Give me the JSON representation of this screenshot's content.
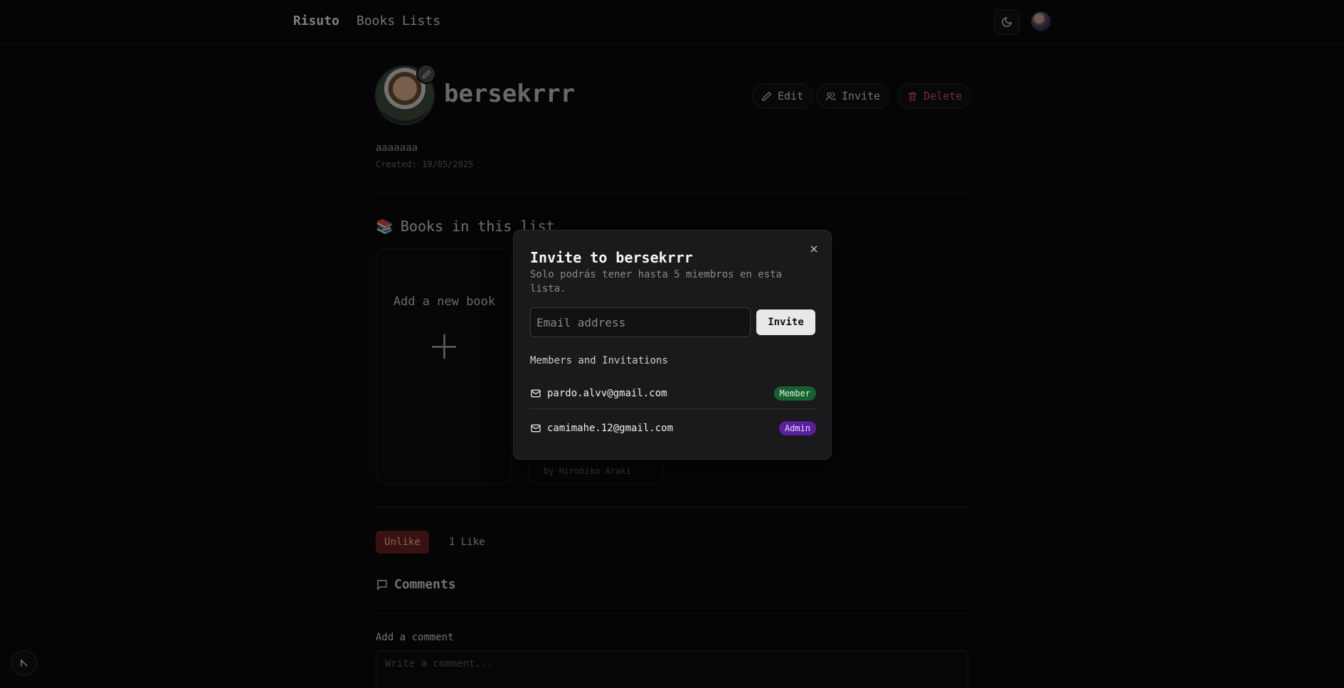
{
  "nav": {
    "brand": "Risuto",
    "links": [
      "Books",
      "Lists"
    ]
  },
  "list": {
    "title": "bersekrrr",
    "description": "aaaaaaa",
    "created": "Created: 19/05/2025",
    "actions": {
      "edit": "Edit",
      "invite": "Invite",
      "delete": "Delete"
    }
  },
  "books_section": {
    "emoji": "📚",
    "title": "Books in this list",
    "add_label": "Add a new book",
    "book_author": "by Hirohiko Araki"
  },
  "likes": {
    "unlike_label": "Unlike",
    "count_label": "1 Like"
  },
  "comments": {
    "title": "Comments",
    "add_label": "Add a comment",
    "placeholder": "Write a comment..."
  },
  "modal": {
    "title": "Invite to bersekrrr",
    "subtitle": "Solo podrás tener hasta 5 miembros en esta lista.",
    "email_placeholder": "Email address",
    "invite_button": "Invite",
    "members_title": "Members and Invitations",
    "members": [
      {
        "email": "pardo.alvv@gmail.com",
        "role": "Member"
      },
      {
        "email": "camimahe.12@gmail.com",
        "role": "Admin"
      }
    ]
  },
  "colors": {
    "background": "#0a0a0a",
    "modal_bg": "#1a1a1c",
    "member_badge": "#16612e",
    "admin_badge": "#5b1f9e",
    "delete": "#d45454",
    "unlike": "#6b1f1f"
  },
  "icons": [
    "moon-icon",
    "pencil-icon",
    "users-icon",
    "trash-icon",
    "close-icon",
    "mail-icon",
    "message-square-icon",
    "plus-icon"
  ]
}
